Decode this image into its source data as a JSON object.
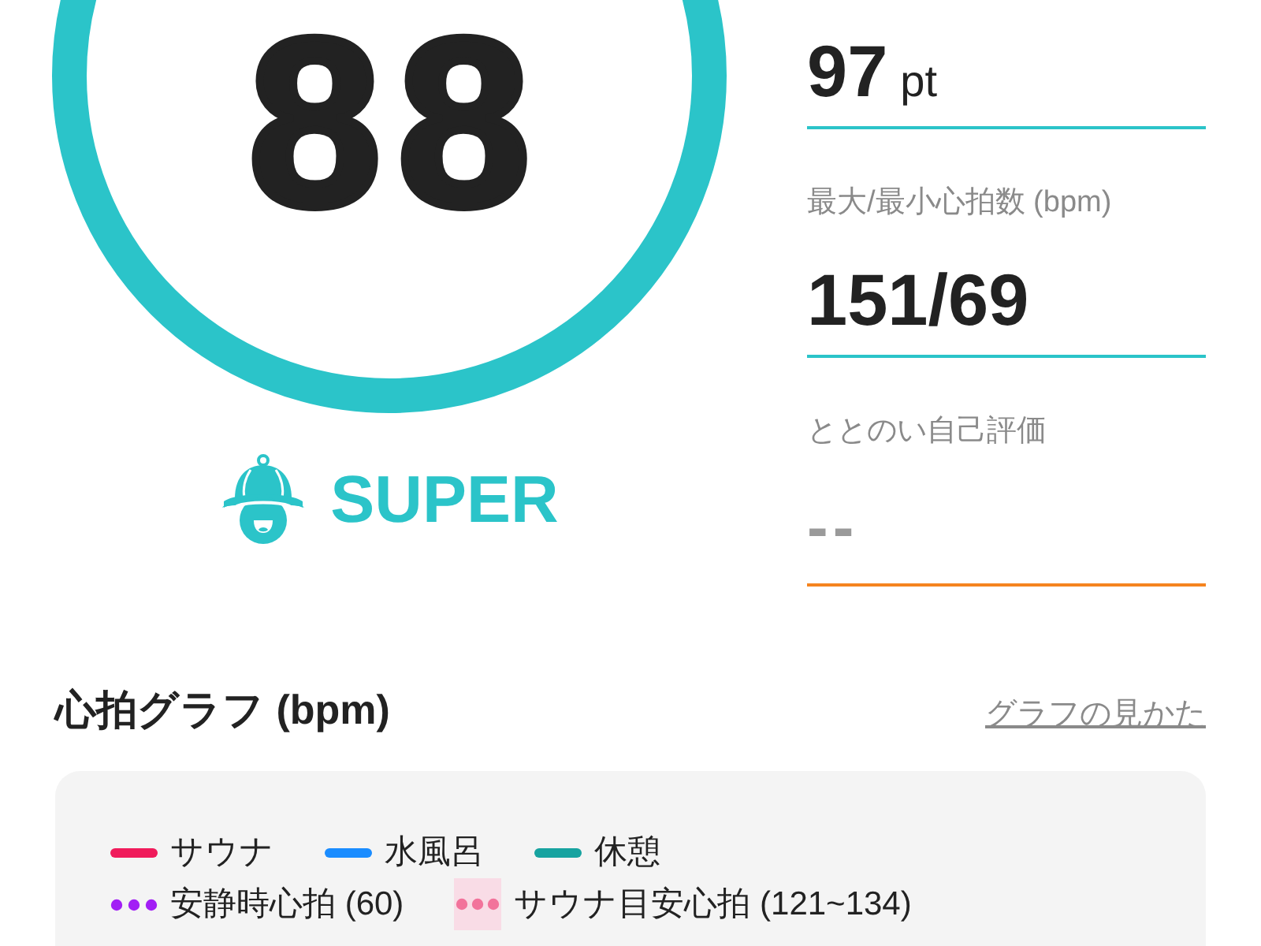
{
  "score": {
    "value": "88"
  },
  "rank": {
    "label": "SUPER"
  },
  "stats": [
    {
      "kind": "number",
      "value": "97",
      "unit": "pt",
      "color": "#2bc4c9"
    },
    {
      "kind": "number",
      "label": "最大/最小心拍数 (bpm)",
      "value": "151/69",
      "color": "#2bc4c9"
    },
    {
      "kind": "empty",
      "label": "ととのい自己評価",
      "value": "--",
      "color": "#f5841f"
    }
  ],
  "heart_rate_graph": {
    "title": "心拍グラフ (bpm)",
    "help_link": "グラフの見かた",
    "legend": [
      [
        {
          "kind": "line",
          "label": "サウナ",
          "color": "#f01b5b"
        },
        {
          "kind": "line",
          "label": "水風呂",
          "color": "#1a8cff"
        },
        {
          "kind": "line",
          "label": "休憩",
          "color": "#17a3a0"
        }
      ],
      [
        {
          "kind": "dots",
          "label": "安静時心拍 (60)",
          "color": "#a21ff5"
        },
        {
          "kind": "band",
          "label": "サウナ目安心拍 (121~134)",
          "color": "#f2739b"
        }
      ]
    ]
  }
}
